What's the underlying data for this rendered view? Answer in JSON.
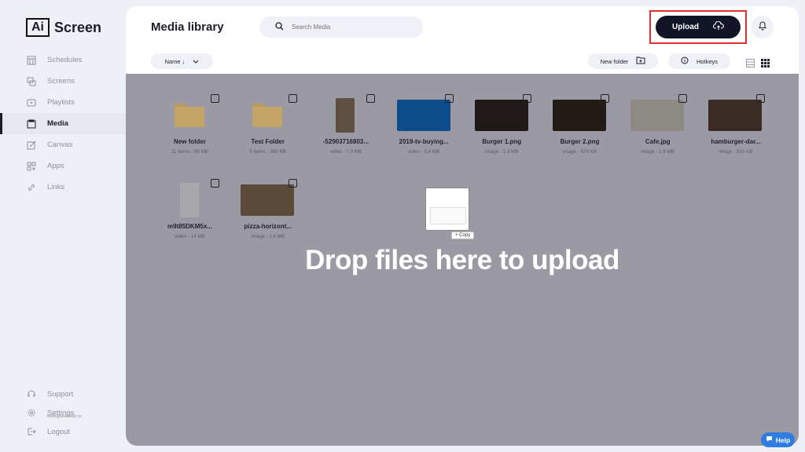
{
  "app": {
    "logo_box": "Ai",
    "logo_text": "Screen"
  },
  "sidebar": {
    "items": [
      {
        "label": "Schedules",
        "icon": "calendar-icon",
        "active": false
      },
      {
        "label": "Screens",
        "icon": "screens-icon",
        "active": false
      },
      {
        "label": "Playlists",
        "icon": "playlist-icon",
        "active": false
      },
      {
        "label": "Media",
        "icon": "media-icon",
        "active": true
      },
      {
        "label": "Canvas",
        "icon": "canvas-icon",
        "active": false
      },
      {
        "label": "Apps",
        "icon": "apps-icon",
        "active": false
      },
      {
        "label": "Links",
        "icon": "link-icon",
        "active": false
      }
    ],
    "bottom": [
      {
        "label": "Support",
        "icon": "headset-icon"
      },
      {
        "label": "Settings",
        "icon": "gear-icon"
      },
      {
        "label": "Logout",
        "icon": "logout-icon"
      }
    ],
    "settings_email": "hello@aiscreen.io"
  },
  "header": {
    "title": "Media library",
    "search_placeholder": "Search Media",
    "upload_label": "Upload"
  },
  "toolbar": {
    "sort_label": "Name ↓",
    "new_folder_label": "New folder",
    "hotkeys_label": "Hotkeys"
  },
  "media": [
    {
      "name": "New folder",
      "meta": "11 items - 89 MB",
      "kind": "folder"
    },
    {
      "name": "Test Folder",
      "meta": "5 items - 365 KB",
      "kind": "folder"
    },
    {
      "name": "-52903716803...",
      "meta": "video - 7.0 MB",
      "kind": "video-tall",
      "color": "#5d5042"
    },
    {
      "name": "2019-tv-buying...",
      "meta": "video - 3.8 MB",
      "kind": "image",
      "color": "#0d4d8c"
    },
    {
      "name": "Burger 1.png",
      "meta": "image - 1.3 MB",
      "kind": "image",
      "color": "#1f1a17"
    },
    {
      "name": "Burger 2.png",
      "meta": "image - 679 KB",
      "kind": "image",
      "color": "#231b16"
    },
    {
      "name": "Cafe.jpg",
      "meta": "image - 1.9 MB",
      "kind": "image",
      "color": "#8d8a86"
    },
    {
      "name": "hamburger-dar...",
      "meta": "image - 533 KB",
      "kind": "image",
      "color": "#3a2b24"
    },
    {
      "name": "m9t85DKM5x...",
      "meta": "video - 14 MB",
      "kind": "video-tall",
      "color": "#a9a9ad"
    },
    {
      "name": "pizza-horizont...",
      "meta": "image - 2.6 MB",
      "kind": "image",
      "color": "#5b4a3a"
    }
  ],
  "overlay": {
    "drop_text": "Drop files here to upload",
    "copy_badge": "+ Copy"
  },
  "help": {
    "label": "Help"
  }
}
